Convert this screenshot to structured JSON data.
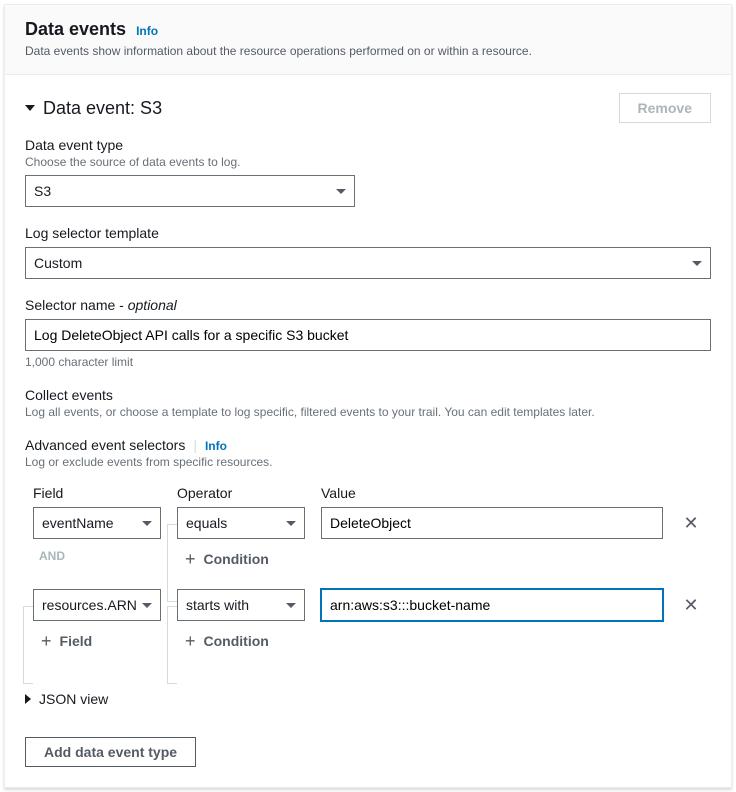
{
  "header": {
    "title": "Data events",
    "info": "Info",
    "description": "Data events show information about the resource operations performed on or within a resource."
  },
  "event": {
    "title": "Data event: S3",
    "remove_label": "Remove"
  },
  "data_event_type": {
    "label": "Data event type",
    "hint": "Choose the source of data events to log.",
    "value": "S3"
  },
  "log_selector": {
    "label": "Log selector template",
    "value": "Custom"
  },
  "selector_name": {
    "label_main": "Selector name",
    "label_suffix": " - ",
    "label_optional": "optional",
    "value": "Log DeleteObject API calls for a specific S3 bucket",
    "char_limit": "1,000 character limit"
  },
  "collect_events": {
    "label": "Collect events",
    "hint": "Log all events, or choose a template to log specific, filtered events to your trail. You can edit templates later."
  },
  "advanced": {
    "label": "Advanced event selectors",
    "info": "Info",
    "hint": "Log or exclude events from specific resources."
  },
  "columns": {
    "field": "Field",
    "operator": "Operator",
    "value": "Value"
  },
  "rows": [
    {
      "field": "eventName",
      "operator": "equals",
      "value": "DeleteObject",
      "focused": false
    },
    {
      "field": "resources.ARN",
      "operator": "starts with",
      "value": "arn:aws:s3:::bucket-name",
      "focused": true
    }
  ],
  "connectors": {
    "and": "AND",
    "condition": "Condition",
    "field": "Field"
  },
  "json_view": "JSON view",
  "add_type_label": "Add data event type"
}
